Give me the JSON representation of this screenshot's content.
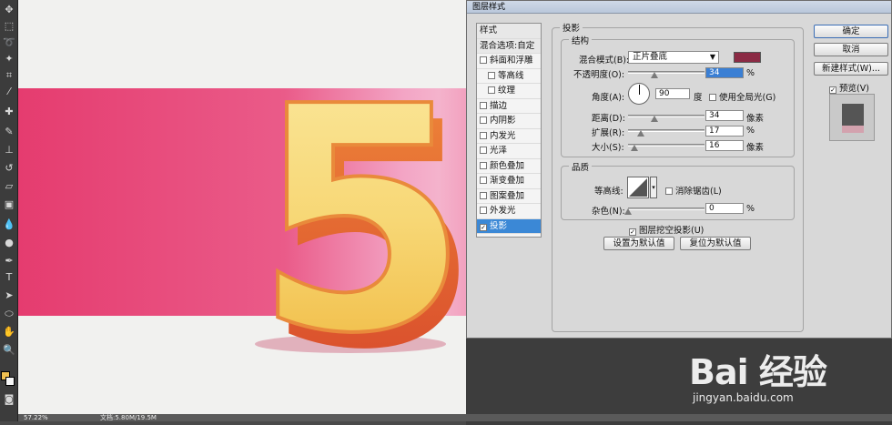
{
  "canvas": {
    "big_number": "5"
  },
  "statusbar": {
    "zoom": "57.22%",
    "doc": "文档:5.80M/19.5M"
  },
  "dialog": {
    "title": "图层样式",
    "styles_header": "样式",
    "blend_options": "混合选项:自定",
    "items": [
      {
        "label": "斜面和浮雕",
        "checked": false,
        "sub": false
      },
      {
        "label": "等高线",
        "checked": false,
        "sub": true
      },
      {
        "label": "纹理",
        "checked": false,
        "sub": true
      },
      {
        "label": "描边",
        "checked": false,
        "sub": false
      },
      {
        "label": "内阴影",
        "checked": false,
        "sub": false
      },
      {
        "label": "内发光",
        "checked": false,
        "sub": false
      },
      {
        "label": "光泽",
        "checked": false,
        "sub": false
      },
      {
        "label": "颜色叠加",
        "checked": false,
        "sub": false
      },
      {
        "label": "渐变叠加",
        "checked": false,
        "sub": false
      },
      {
        "label": "图案叠加",
        "checked": false,
        "sub": false
      },
      {
        "label": "外发光",
        "checked": false,
        "sub": false
      },
      {
        "label": "投影",
        "checked": true,
        "sub": false,
        "selected": true
      }
    ],
    "section_title": "投影",
    "structure": {
      "legend": "结构",
      "blend_mode_label": "混合模式(B):",
      "blend_mode_value": "正片叠底",
      "shadow_color": "#8b2a44",
      "opacity_label": "不透明度(O):",
      "opacity_value": "34",
      "opacity_fraction": 0.34,
      "opacity_unit": "%",
      "angle_label": "角度(A):",
      "angle_value": "90",
      "angle_unit": "度",
      "global_light_label": "使用全局光(G)",
      "global_light_checked": false,
      "distance_label": "距离(D):",
      "distance_value": "34",
      "distance_fraction": 0.34,
      "distance_unit": "像素",
      "spread_label": "扩展(R):",
      "spread_value": "17",
      "spread_fraction": 0.17,
      "spread_unit": "%",
      "size_label": "大小(S):",
      "size_value": "16",
      "size_fraction": 0.08,
      "size_unit": "像素"
    },
    "quality": {
      "legend": "品质",
      "contour_label": "等高线:",
      "anti_alias_label": "消除锯齿(L)",
      "anti_alias_checked": false,
      "noise_label": "杂色(N):",
      "noise_value": "0",
      "noise_fraction": 0,
      "noise_unit": "%"
    },
    "knockout_label": "图层挖空投影(U)",
    "knockout_checked": true,
    "set_default": "设置为默认值",
    "reset_default": "复位为默认值",
    "ok": "确定",
    "cancel": "取消",
    "new_style": "新建样式(W)...",
    "preview_label": "预览(V)",
    "preview_checked": true
  },
  "watermark": {
    "brand": "Bai 经验",
    "url": "jingyan.baidu.com"
  }
}
